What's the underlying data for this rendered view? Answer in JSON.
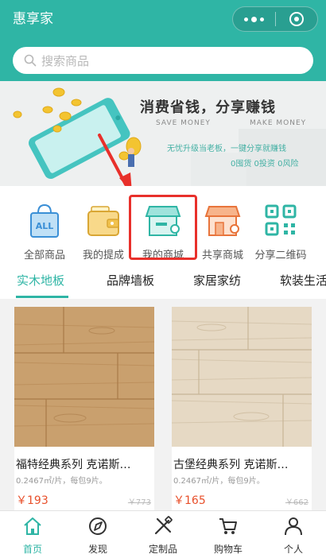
{
  "header": {
    "title": "惠享家",
    "search_placeholder": "搜索商品"
  },
  "banner": {
    "title": "消费省钱，分享赚钱",
    "sub_left": "SAVE MONEY",
    "sub_right": "MAKE MONEY",
    "line1": "无忧升级当老板，一键分享就赚钱",
    "line2": "0囤货 0投资 0风险"
  },
  "categories": [
    {
      "label": "全部商品",
      "icon": "all-bag-icon"
    },
    {
      "label": "我的提成",
      "icon": "wallet-icon"
    },
    {
      "label": "我的商城",
      "icon": "shop-icon"
    },
    {
      "label": "共享商城",
      "icon": "shared-shop-icon"
    },
    {
      "label": "分享二维码",
      "icon": "qr-code-icon"
    }
  ],
  "tabs": [
    "实木地板",
    "品牌墙板",
    "家居家纺",
    "软装生活"
  ],
  "active_tab": 0,
  "products": [
    {
      "name": "福特经典系列 克诺斯…",
      "spec": "0.2467㎡/片，每包9片。",
      "price": "￥193",
      "old_price": "￥773"
    },
    {
      "name": "古堡经典系列 克诺斯…",
      "spec": "0.2467㎡/片，每包9片。",
      "price": "￥165",
      "old_price": "￥662"
    }
  ],
  "nav": [
    {
      "label": "首页",
      "icon": "home-icon"
    },
    {
      "label": "发现",
      "icon": "discover-icon"
    },
    {
      "label": "定制品",
      "icon": "custom-tools-icon"
    },
    {
      "label": "购物车",
      "icon": "cart-icon"
    },
    {
      "label": "个人",
      "icon": "person-icon"
    }
  ],
  "colors": {
    "accent": "#2fb5a5",
    "highlight": "#e8302b",
    "price": "#e8502b"
  }
}
